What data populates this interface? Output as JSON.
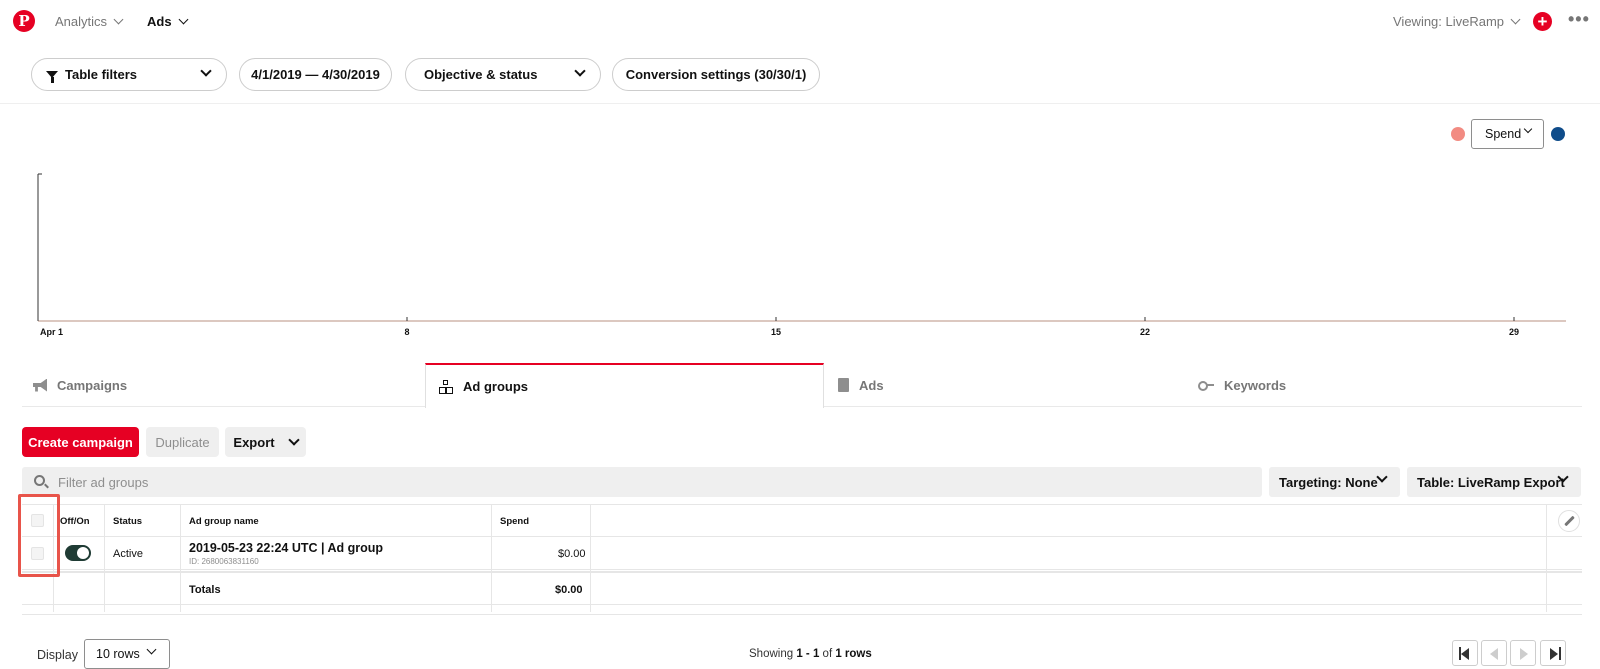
{
  "nav": {
    "logo": "P",
    "analytics": "Analytics",
    "ads": "Ads",
    "viewing": "Viewing: LiveRamp"
  },
  "filters": {
    "table_filters": "Table filters",
    "date_range": "4/1/2019 — 4/30/2019",
    "objective_status": "Objective & status",
    "conversion_settings": "Conversion settings (30/30/1)"
  },
  "chart": {
    "metric_select": "Spend",
    "colors": {
      "left_metric": "#f28b82",
      "right_metric": "#0f4c8a"
    }
  },
  "chart_data": {
    "type": "line",
    "x_tick_labels": [
      "Apr 1",
      "8",
      "15",
      "22",
      "29"
    ],
    "series": [],
    "grid": false
  },
  "tabs": [
    {
      "label": "Campaigns",
      "icon": "megaphone-icon",
      "active": false
    },
    {
      "label": "Ad groups",
      "icon": "ad-groups-icon",
      "active": true
    },
    {
      "label": "Ads",
      "icon": "book-icon",
      "active": false
    },
    {
      "label": "Keywords",
      "icon": "key-icon",
      "active": false
    }
  ],
  "actions": {
    "create": "Create campaign",
    "duplicate": "Duplicate",
    "export": "Export"
  },
  "search": {
    "placeholder": "Filter ad groups"
  },
  "dropdowns": {
    "targeting": "Targeting: None",
    "table": "Table: LiveRamp Export"
  },
  "table": {
    "headers": {
      "toggle": "Off/On",
      "status": "Status",
      "name": "Ad group name",
      "spend": "Spend"
    },
    "rows": [
      {
        "status": "Active",
        "name": "2019-05-23 22:24 UTC | Ad group",
        "id": "ID: 2680063831160",
        "spend": "$0.00",
        "enabled": true
      }
    ],
    "totals": {
      "label": "Totals",
      "spend": "$0.00"
    }
  },
  "footer": {
    "display_label": "Display",
    "rows_select": "10 rows",
    "showing_prefix": "Showing",
    "showing_range": "1 - 1",
    "showing_of": "of",
    "showing_total": "1 rows"
  },
  "colors": {
    "brand": "#e60023",
    "highlight": "#e8544a"
  }
}
